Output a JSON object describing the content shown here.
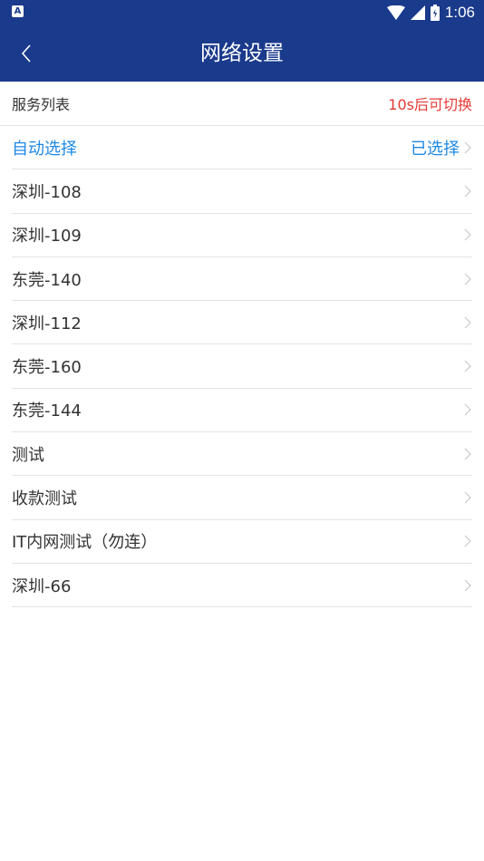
{
  "status_bar": {
    "left_icon": "A",
    "time": "1:06"
  },
  "nav": {
    "title": "网络设置"
  },
  "list": {
    "header_label": "服务列表",
    "header_hint": "10s后可切换",
    "items": [
      {
        "label": "自动选择",
        "status": "已选择"
      },
      {
        "label": "深圳-108"
      },
      {
        "label": "深圳-109"
      },
      {
        "label": "东莞-140"
      },
      {
        "label": "深圳-112"
      },
      {
        "label": "东莞-160"
      },
      {
        "label": "东莞-144"
      },
      {
        "label": "测试"
      },
      {
        "label": "收款测试"
      },
      {
        "label": "IT内网测试（勿连）"
      },
      {
        "label": "深圳-66"
      }
    ]
  },
  "colors": {
    "primary": "#1a3a8c",
    "accent_blue": "#1e88e5",
    "hint_red": "#e53935",
    "divider": "#e3e3e3"
  }
}
